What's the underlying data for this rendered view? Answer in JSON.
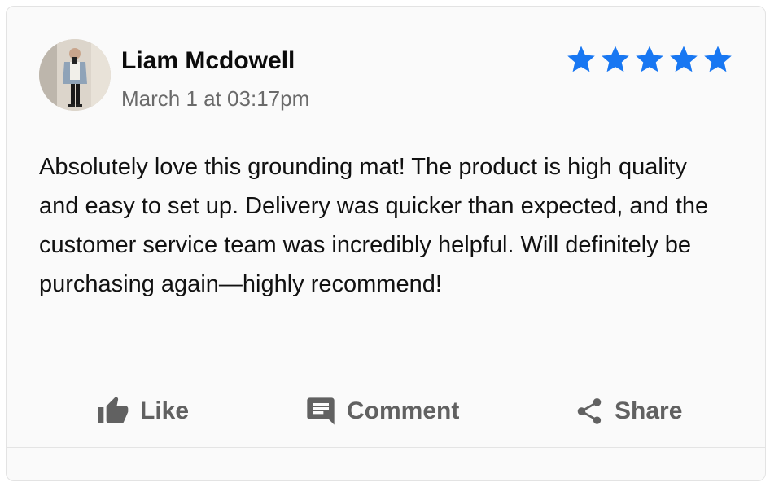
{
  "review": {
    "author": "Liam Mcdowell",
    "date": "March 1 at 03:17pm",
    "rating": 5,
    "max_rating": 5,
    "star_color": "#1877f2",
    "text": "Absolutely love this grounding mat! The product is high quality and easy to set up. Delivery was quicker than expected, and the customer service team was incredibly helpful. Will definitely be purchasing again—highly recommend!"
  },
  "actions": {
    "like": {
      "label": "Like",
      "icon": "thumbs-up-icon"
    },
    "comment": {
      "label": "Comment",
      "icon": "comment-icon"
    },
    "share": {
      "label": "Share",
      "icon": "share-icon"
    }
  },
  "colors": {
    "card_background": "#fafafa",
    "action_text": "#616161",
    "date_text": "#6a6a6a"
  }
}
